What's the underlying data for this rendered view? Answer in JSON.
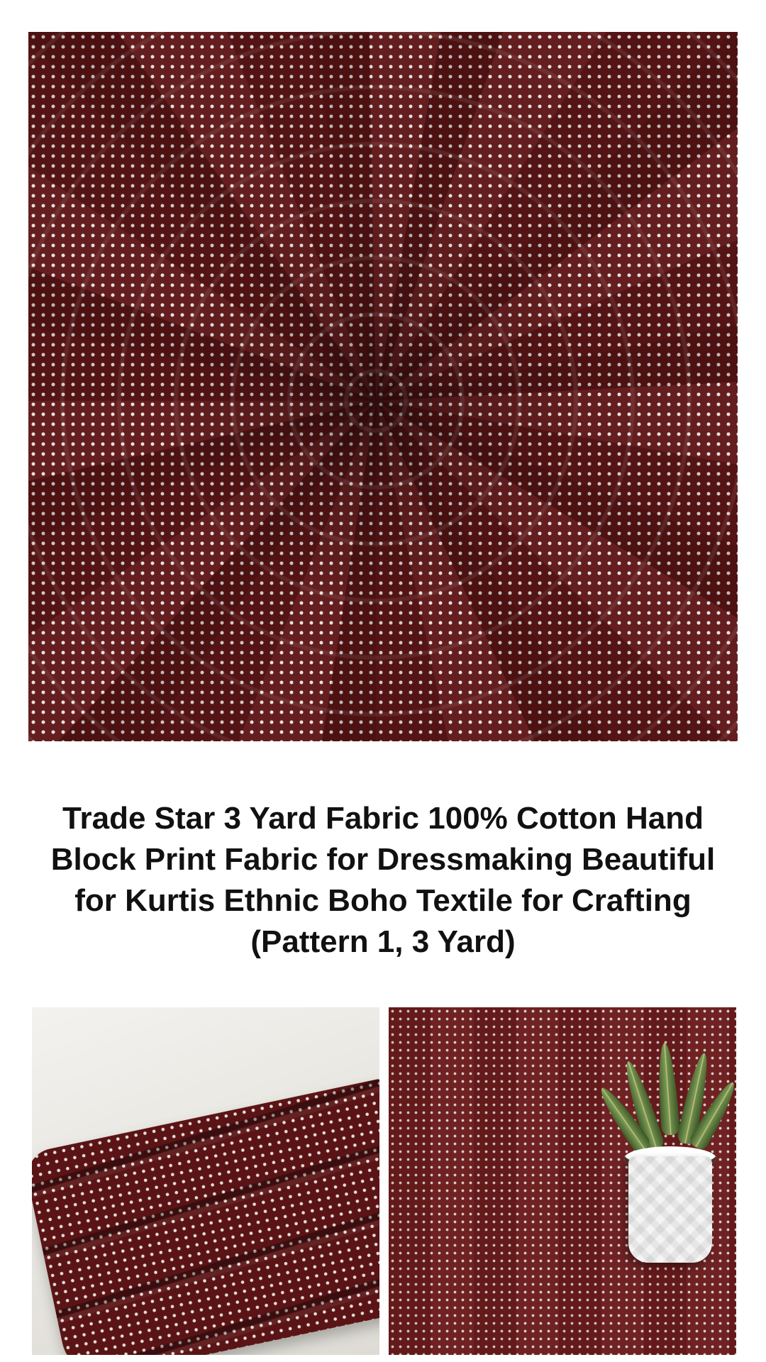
{
  "product": {
    "title": "Trade Star 3 Yard Fabric 100% Cotton Hand Block Print Fabric for Dressmaking Beautiful for Kurtis Ethnic Boho Textile for Crafting (Pattern 1, 3 Yard)"
  },
  "colors": {
    "fabric": "#5e1516",
    "dot": "#e8e0e0",
    "background": "#ffffff",
    "text": "#111111"
  }
}
